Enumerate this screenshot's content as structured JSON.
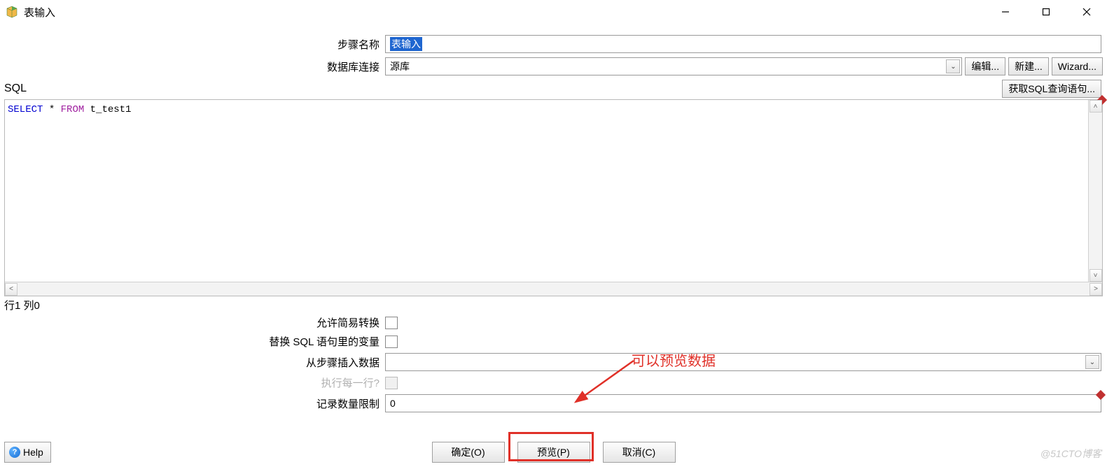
{
  "window": {
    "title": "表输入",
    "min_label": "—",
    "max_label": "□",
    "close_label": "×"
  },
  "form": {
    "step_name_label": "步骤名称",
    "step_name_value": "表输入",
    "db_conn_label": "数据库连接",
    "db_conn_value": "源库",
    "edit_btn": "编辑...",
    "new_btn": "新建...",
    "wizard_btn": "Wizard..."
  },
  "sql": {
    "label": "SQL",
    "get_sql_btn": "获取SQL查询语句...",
    "code_kw1": "SELECT",
    "code_op": " * ",
    "code_kw2": "FROM",
    "code_rest": " t_test1",
    "cursor_pos": "行1 列0"
  },
  "options": {
    "allow_lazy_label": "允许简易转换",
    "replace_vars_label": "替换 SQL 语句里的变量",
    "insert_from_step_label": "从步骤插入数据",
    "insert_from_step_value": "",
    "exec_each_row_label": "执行每一行?",
    "record_limit_label": "记录数量限制",
    "record_limit_value": "0"
  },
  "annotation": {
    "text": "可以预览数据"
  },
  "buttons": {
    "help": "Help",
    "ok": "确定(O)",
    "preview": "预览(P)",
    "cancel": "取消(C)"
  },
  "watermark": "@51CTO博客"
}
